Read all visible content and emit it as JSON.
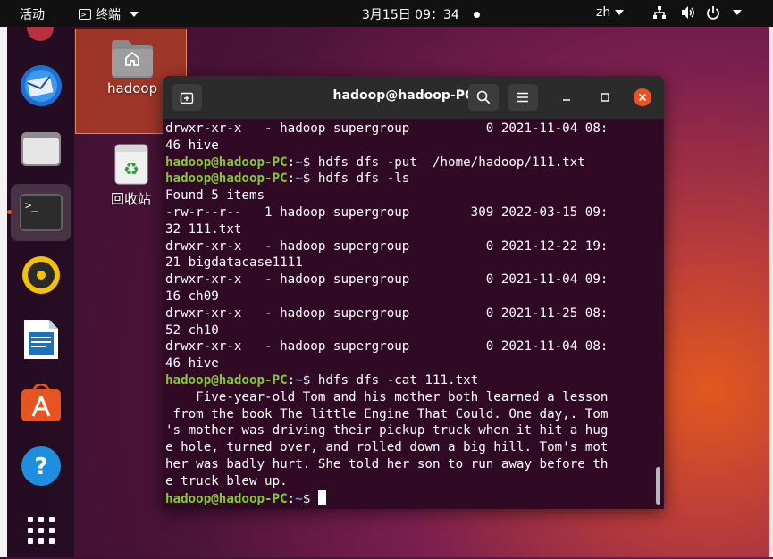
{
  "topbar": {
    "activities": "活动",
    "app_name": "终端",
    "clock": "3月15日  09：34",
    "language": "zh"
  },
  "dock": {
    "items": [
      "thunderbird",
      "files",
      "terminal",
      "rhythmbox",
      "libreoffice-writer",
      "software-center",
      "help",
      "show-applications"
    ]
  },
  "desktop": {
    "home_label": "hadoop",
    "trash_label": "回收站"
  },
  "terminal": {
    "title": "hadoop@hadoop-PC: ~",
    "lines": [
      {
        "text": "drwxr-xr-x   - hadoop supergroup          0 2021-11-04 08:"
      },
      {
        "text": "46 hive"
      },
      {
        "user": "hadoop@hadoop-PC",
        "path": "~",
        "cmd": "$ hdfs dfs -put  /home/hadoop/111.txt"
      },
      {
        "user": "hadoop@hadoop-PC",
        "path": "~",
        "cmd": "$ hdfs dfs -ls"
      },
      {
        "text": "Found 5 items"
      },
      {
        "text": "-rw-r--r--   1 hadoop supergroup        309 2022-03-15 09:"
      },
      {
        "text": "32 111.txt"
      },
      {
        "text": "drwxr-xr-x   - hadoop supergroup          0 2021-12-22 19:"
      },
      {
        "text": "21 bigdatacase1111"
      },
      {
        "text": "drwxr-xr-x   - hadoop supergroup          0 2021-11-04 09:"
      },
      {
        "text": "16 ch09"
      },
      {
        "text": "drwxr-xr-x   - hadoop supergroup          0 2021-11-25 08:"
      },
      {
        "text": "52 ch10"
      },
      {
        "text": "drwxr-xr-x   - hadoop supergroup          0 2021-11-04 08:"
      },
      {
        "text": "46 hive"
      },
      {
        "user": "hadoop@hadoop-PC",
        "path": "~",
        "cmd": "$ hdfs dfs -cat 111.txt"
      },
      {
        "text": "    Five-year-old Tom and his mother both learned a lesson"
      },
      {
        "text": " from the book The little Engine That Could. One day,. Tom"
      },
      {
        "text": "'s mother was driving their pickup truck when it hit a hug"
      },
      {
        "text": "e hole, turned over, and rolled down a big hill. Tom's mot"
      },
      {
        "text": "her was badly hurt. She told her son to run away before th"
      },
      {
        "text": "e truck blew up."
      },
      {
        "user": "hadoop@hadoop-PC",
        "path": "~",
        "cmd": "$ ",
        "cursor": true
      }
    ]
  },
  "colors": {
    "accent": "#e95420",
    "terminal_bg": "#300a24",
    "prompt_user": "#87c63a",
    "prompt_path": "#6b9ed6"
  }
}
